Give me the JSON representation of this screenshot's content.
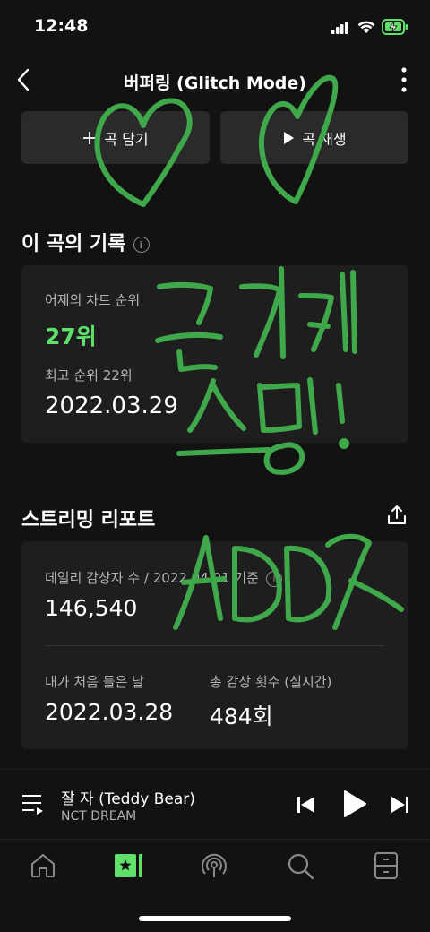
{
  "status": {
    "time": "12:48"
  },
  "header": {
    "title": "버퍼링 (Glitch Mode)"
  },
  "actions": {
    "add_label": "곡 담기",
    "play_label": "곡 재생"
  },
  "history": {
    "heading": "이 곡의 기록",
    "chart_rank_label": "어제의 차트 순위",
    "chart_rank_value": "27위",
    "best_rank_label": "최고 순위 22위",
    "best_rank_date": "2022.03.29"
  },
  "report": {
    "heading": "스트리밍 리포트",
    "daily_label": "데일리 감상자 수 / 2022.04.01 기준",
    "daily_value": "146,540",
    "first_listen_label": "내가 처음 들은 날",
    "first_listen_value": "2022.03.28",
    "total_plays_label": "총 감상 횟수 (실시간)",
    "total_plays_value": "484회"
  },
  "now_playing": {
    "title": "잘 자 (Teddy Bear)",
    "artist": "NCT DREAM"
  },
  "tabs": [
    {
      "icon": "home-icon"
    },
    {
      "icon": "library-icon",
      "active": true
    },
    {
      "icon": "podcast-icon"
    },
    {
      "icon": "search-icon"
    },
    {
      "icon": "storage-icon"
    }
  ],
  "colors": {
    "accent": "#5ee06a",
    "background": "#121212",
    "card": "#1e1e1e",
    "doodle": "#3fa84a"
  }
}
